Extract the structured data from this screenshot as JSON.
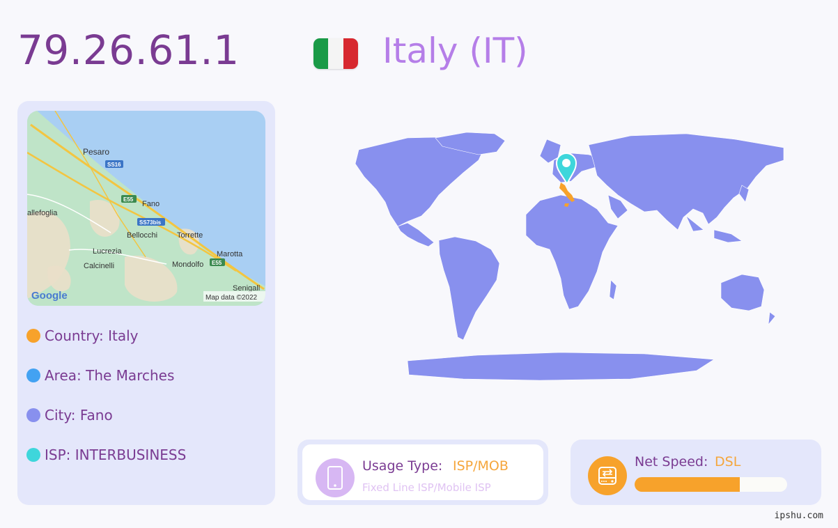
{
  "ip": "79.26.61.1",
  "country_display": "Italy (IT)",
  "flag": {
    "colors": [
      "#1a9a47",
      "#f4f4f4",
      "#d7282f"
    ]
  },
  "map": {
    "places": [
      "Pesaro",
      "allefoglia",
      "Fano",
      "Bellocchi",
      "Torrette",
      "Lucrezia",
      "Marotta",
      "Calcinelli",
      "Mondolfo",
      "Senigall"
    ],
    "road_labels": [
      "SS16",
      "E55",
      "SS73bis",
      "E55"
    ],
    "logo": "Google",
    "attribution": "Map data ©2022"
  },
  "info": [
    {
      "text": "Country: Italy",
      "color": "#f7a22b"
    },
    {
      "text": "Area: The Marches",
      "color": "#43a2f2"
    },
    {
      "text": "City: Fano",
      "color": "#8890ee"
    },
    {
      "text": "ISP: INTERBUSINESS",
      "color": "#3ed6db"
    }
  ],
  "world_map": {
    "land_color": "#8890ee",
    "highlight_color": "#f7a22b",
    "marker_color": "#3ed6db"
  },
  "usage": {
    "label": "Usage Type:",
    "value": "ISP/MOB",
    "sub": "Fixed Line ISP/Mobile ISP",
    "icon": "mobile-phone-icon"
  },
  "speed": {
    "label": "Net Speed:",
    "value": "DSL",
    "level": 0.69,
    "icon": "network-drive-icon"
  },
  "footer": "ipshu.com"
}
